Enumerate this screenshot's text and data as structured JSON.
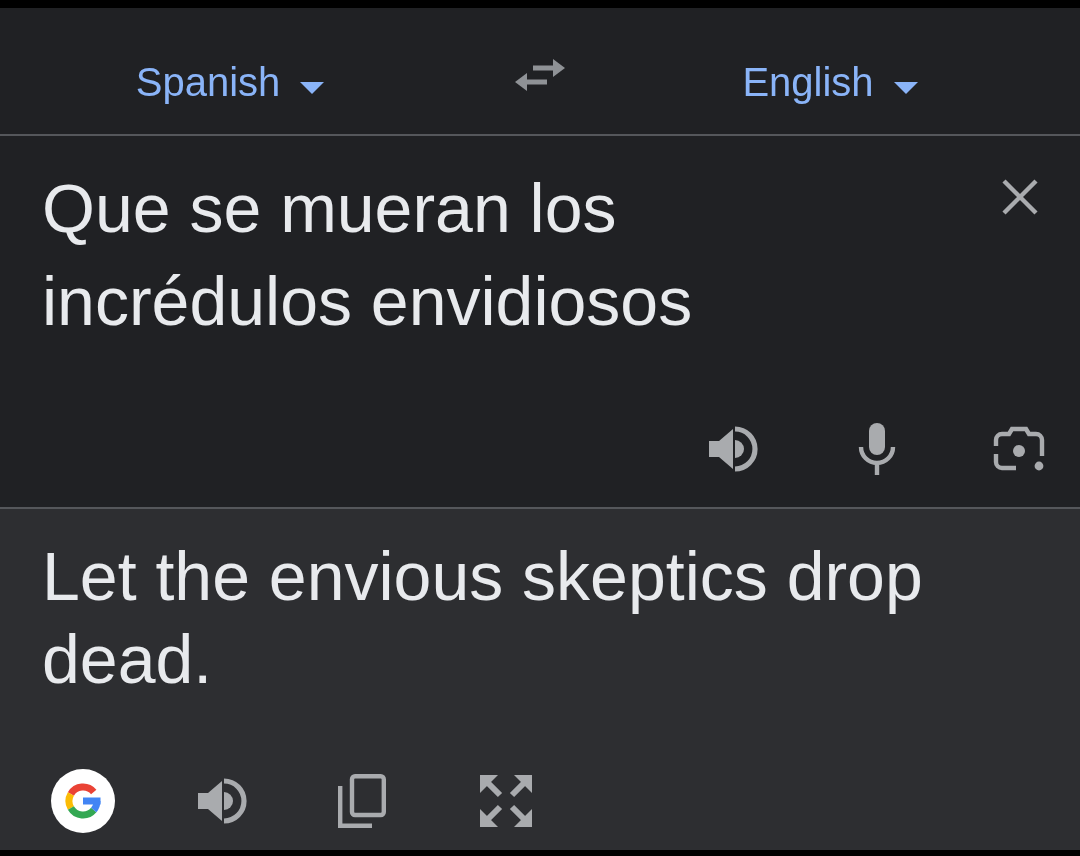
{
  "language_bar": {
    "source_language": "Spanish",
    "target_language": "English"
  },
  "input": {
    "text": "Que se mueran los incrédulos envidiosos"
  },
  "translation": {
    "text": "Let the envious skeptics drop dead."
  }
}
